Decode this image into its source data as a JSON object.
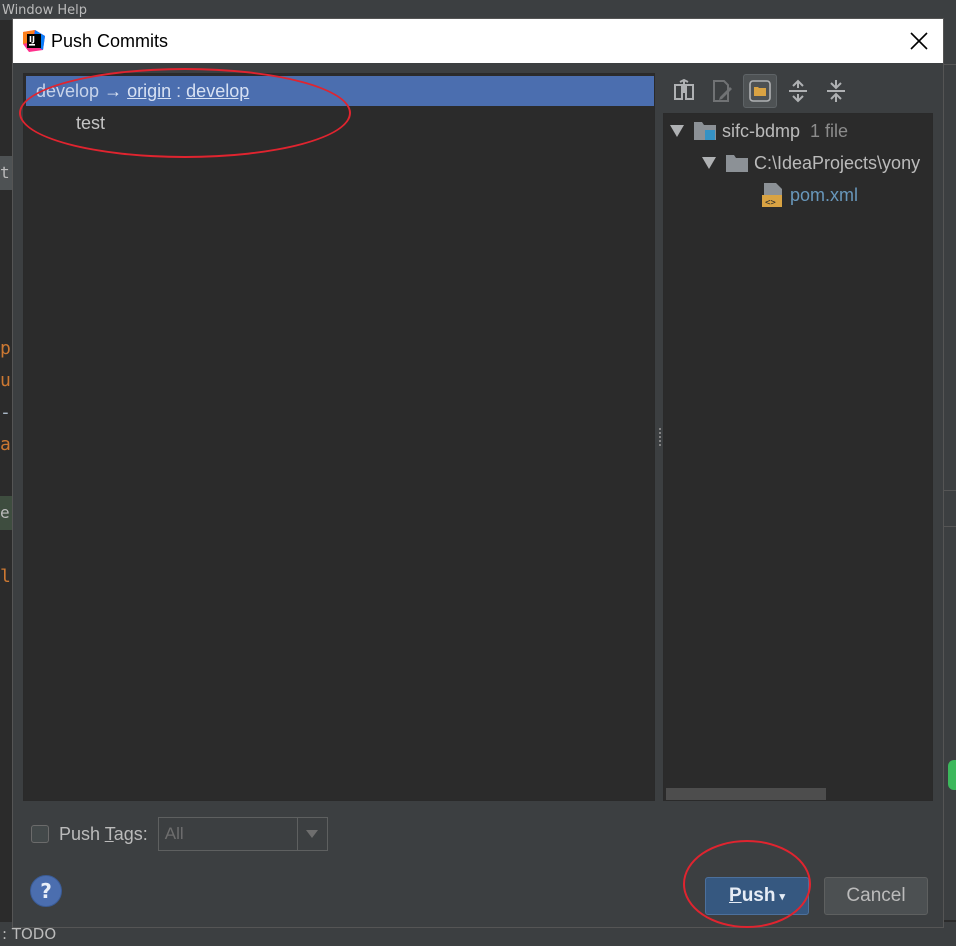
{
  "background": {
    "top_strip_text": "Window Help",
    "status_text": ": TODO",
    "editor_fragments": [
      "t",
      "p",
      "u",
      "-",
      "a",
      "e",
      "le"
    ]
  },
  "dialog": {
    "title": "Push Commits",
    "close_icon": "close-icon"
  },
  "commits": {
    "branch": {
      "local": "develop",
      "arrow": "→",
      "remote": "origin",
      "separator": ":",
      "remote_branch": "develop"
    },
    "items": [
      {
        "message": "test"
      }
    ]
  },
  "toolbar": {
    "buttons": [
      {
        "icon": "diff-icon",
        "enabled": true
      },
      {
        "icon": "edit-source-icon",
        "enabled": false
      },
      {
        "icon": "group-by-directory-icon",
        "active": true
      },
      {
        "icon": "expand-all-icon",
        "enabled": true
      },
      {
        "icon": "collapse-all-icon",
        "enabled": true
      }
    ]
  },
  "changes_tree": {
    "root": {
      "name": "sifc-bdmp",
      "count": "1 file"
    },
    "folder": {
      "name": "C:\\IdeaProjects\\yony"
    },
    "file": {
      "name": "pom.xml"
    }
  },
  "footer": {
    "push_tags_prefix": "Push ",
    "push_tags_mnemonic": "T",
    "push_tags_suffix": "ags:",
    "push_tags_checked": false,
    "tags_select_value": "All",
    "help_label": "?",
    "push_button_mnemonic": "P",
    "push_button_rest": "ush",
    "cancel_button": "Cancel"
  },
  "colors": {
    "selection": "#4b6eaf",
    "push_button": "#365880",
    "annotation": "#e0242f",
    "file_link": "#6897bb"
  }
}
